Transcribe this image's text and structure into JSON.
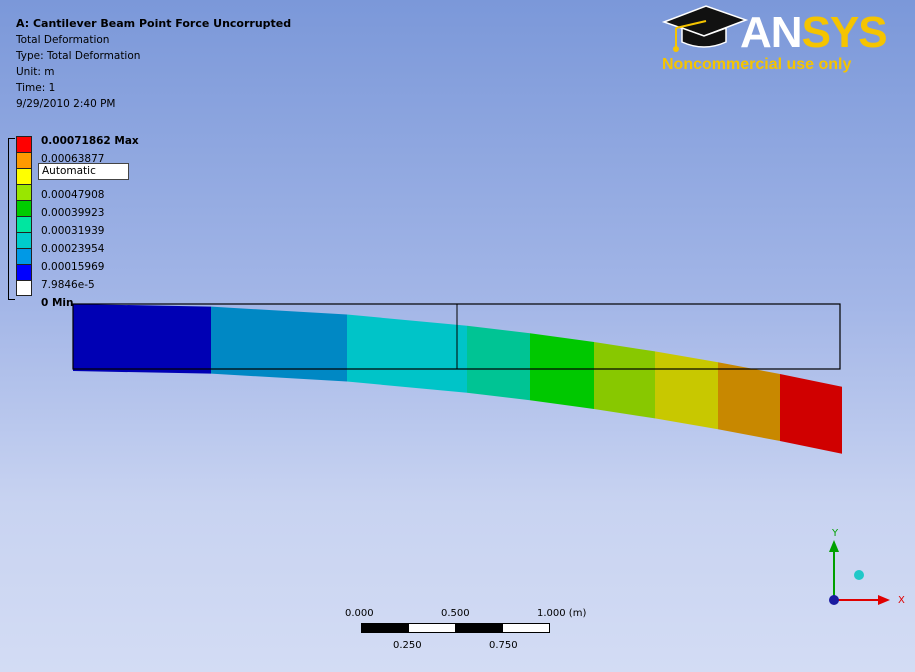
{
  "info": {
    "title": "A: Cantilever Beam Point Force Uncorrupted",
    "result_name": "Total Deformation",
    "type": "Type: Total Deformation",
    "unit": "Unit: m",
    "time": "Time: 1",
    "date": "9/29/2010 2:40 PM"
  },
  "legend": {
    "max_label": "0.00071862 Max",
    "labels": [
      "0.00063877",
      "",
      "0.00047908",
      "0.00039923",
      "0.00031939",
      "0.00023954",
      "0.00015969",
      "7.9846e-5"
    ],
    "min_label": "0 Min",
    "auto_dropdown": "Automatic",
    "colors": [
      "#ff0000",
      "#ff9900",
      "#ffff00",
      "#99e600",
      "#00cc00",
      "#00e6a0",
      "#00cccc",
      "#0099e6",
      "#0000ff",
      "#ffffff"
    ]
  },
  "logo": {
    "brand_an": "AN",
    "brand_sys": "SYS",
    "tagline": "Noncommercial use only"
  },
  "scale_bar": {
    "top_labels": [
      "0.000",
      "0.500",
      "1.000 (m)"
    ],
    "bottom_labels": [
      "0.250",
      "0.750"
    ]
  },
  "triad": {
    "x_label": "X",
    "y_label": "Y"
  },
  "beam_colors": [
    "#0000b4",
    "#0088c4",
    "#00c4c8",
    "#00c494",
    "#00c800",
    "#88c800",
    "#c8c800",
    "#c88800",
    "#d00000"
  ]
}
